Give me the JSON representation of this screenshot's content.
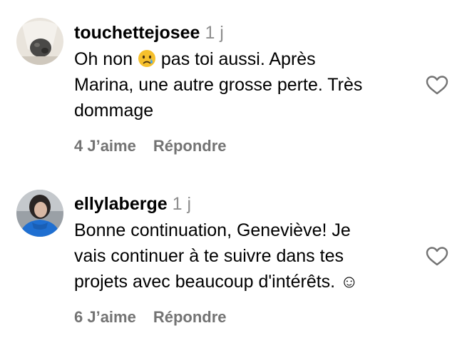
{
  "comments": [
    {
      "username": "touchettejosee",
      "time": "1 j",
      "text_before_emoji": "Oh non ",
      "emoji": "sad-tear-face",
      "text_after_emoji": " pas toi aussi. Après\nMarina, une autre grosse perte. Très\ndommage",
      "likes": "4 J’aime",
      "reply": "Répondre",
      "like_icon": "heart-outline-icon"
    },
    {
      "username": "ellylaberge",
      "time": "1 j",
      "text": "Bonne continuation, Geneviève! Je\nvais continuer à te suivre dans tes\nprojets avec beaucoup d'intérêts. ☺",
      "likes": "6 J’aime",
      "reply": "Répondre",
      "like_icon": "heart-outline-icon"
    }
  ],
  "colors": {
    "text": "#000000",
    "secondary": "#8e8e8e",
    "action": "#737373",
    "emoji_yellow": "#f6c02c",
    "tear_blue": "#4aa8e8",
    "avatar2_blue": "#1f6fd1"
  }
}
